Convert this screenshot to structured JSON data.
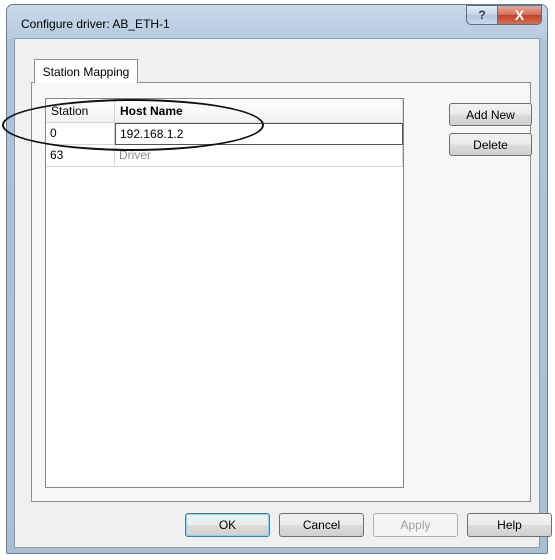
{
  "window": {
    "title": "Configure driver: AB_ETH-1",
    "help_glyph": "?",
    "close_glyph": "X"
  },
  "tabs": [
    {
      "label": "Station Mapping",
      "selected": true
    }
  ],
  "table": {
    "columns": [
      "Station",
      "Host Name"
    ],
    "rows": [
      {
        "station": "0",
        "host": "192.168.1.2"
      },
      {
        "station": "63",
        "host": "Driver"
      }
    ]
  },
  "side_buttons": {
    "add": "Add New",
    "delete": "Delete"
  },
  "dialog_buttons": {
    "ok": "OK",
    "cancel": "Cancel",
    "apply": "Apply",
    "help": "Help"
  }
}
